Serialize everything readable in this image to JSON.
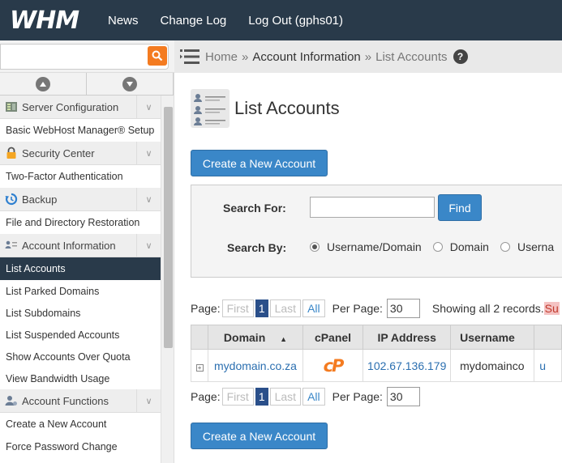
{
  "topbar": {
    "logo": "WHM",
    "nav": [
      "News",
      "Change Log",
      "Log Out (gphs01)"
    ]
  },
  "search": {
    "placeholder": "",
    "value": ""
  },
  "breadcrumb": {
    "home": "Home",
    "section": "Account Information",
    "page": "List Accounts",
    "help": "?"
  },
  "sidebar": {
    "groups": [
      {
        "label": "Server Configuration",
        "icon": "server-config-icon",
        "items": [
          "Basic WebHost Manager® Setup"
        ]
      },
      {
        "label": "Security Center",
        "icon": "lock-icon",
        "items": [
          "Two-Factor Authentication"
        ]
      },
      {
        "label": "Backup",
        "icon": "backup-icon",
        "items": [
          "File and Directory Restoration"
        ]
      },
      {
        "label": "Account Information",
        "icon": "account-info-icon",
        "items": [
          "List Accounts",
          "List Parked Domains",
          "List Subdomains",
          "List Suspended Accounts",
          "Show Accounts Over Quota",
          "View Bandwidth Usage"
        ]
      },
      {
        "label": "Account Functions",
        "icon": "account-functions-icon",
        "items": [
          "Create a New Account",
          "Force Password Change"
        ]
      }
    ],
    "active_item": "List Accounts"
  },
  "main": {
    "title": "List Accounts",
    "create_button": "Create a New Account",
    "search_panel": {
      "search_for_label": "Search For:",
      "search_for_value": "",
      "find_button": "Find",
      "search_by_label": "Search By:",
      "options": [
        "Username/Domain",
        "Domain",
        "Userna"
      ],
      "selected": "Username/Domain"
    },
    "pager": {
      "page_label": "Page:",
      "first": "First",
      "current": "1",
      "last": "Last",
      "all": "All",
      "per_page_label": "Per Page:",
      "per_page_value": "30",
      "showing": "Showing all 2 records.",
      "showing_extra": "Su"
    },
    "table": {
      "columns": [
        "Domain",
        "cPanel",
        "IP Address",
        "Username"
      ],
      "sort_indicator": "▲",
      "rows": [
        {
          "domain": "mydomain.co.za",
          "cpanel": "cP",
          "ip": "102.67.136.179",
          "username": "mydomainco",
          "extra": "u"
        }
      ]
    }
  },
  "colors": {
    "topbar": "#293a4a",
    "accent": "#3a87c8",
    "orange": "#f47b20"
  }
}
